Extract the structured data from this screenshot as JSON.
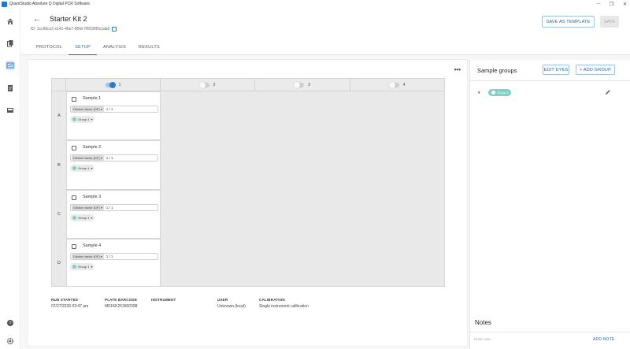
{
  "window": {
    "title": "QuantStudio Absolute Q Digital PCR Software",
    "minimize_glyph": "–",
    "maximize_glyph": "❐",
    "close_glyph": "✕"
  },
  "rail": {
    "items": [
      {
        "icon": "home-icon"
      },
      {
        "icon": "files-icon"
      },
      {
        "icon": "plate-setup-icon",
        "active": true
      },
      {
        "icon": "document-list-icon"
      },
      {
        "icon": "instrument-icon"
      }
    ],
    "bottom": [
      {
        "icon": "help-icon"
      },
      {
        "icon": "settings-icon"
      }
    ]
  },
  "header": {
    "back_glyph": "←",
    "title": "Starter Kit 2",
    "id_text": "ID: 1cc96cc2-c141-45e7-80fd-7f6539f0c1da0",
    "save_template_label": "SAVE AS TEMPLATE",
    "save_label": "SAVE",
    "tabs": [
      {
        "label": "PROTOCOL"
      },
      {
        "label": "SETUP"
      },
      {
        "label": "ANALYSIS"
      },
      {
        "label": "RESULTS"
      }
    ]
  },
  "plate": {
    "more_glyph": "•••",
    "columns": [
      {
        "label": "1",
        "on": true
      },
      {
        "label": "2",
        "on": false
      },
      {
        "label": "3",
        "on": false
      },
      {
        "label": "4",
        "on": false
      }
    ],
    "rows": [
      {
        "label": "A",
        "sample": "Sample 1",
        "df_chip": "Dilution factor (DF)",
        "df_value": "1 / 1",
        "group": "Group 1"
      },
      {
        "label": "B",
        "sample": "Sample 2",
        "df_chip": "Dilution factor (DF)",
        "df_value": "1 / 1",
        "group": "Group 1"
      },
      {
        "label": "C",
        "sample": "Sample 3",
        "df_chip": "Dilution factor (DF)",
        "df_value": "1 / 1",
        "group": "Group 1"
      },
      {
        "label": "D",
        "sample": "Sample 4",
        "df_chip": "Dilution factor (DF)",
        "df_value": "1 / 1",
        "group": "Group 1"
      }
    ],
    "chip_caret": "▾",
    "group_color": "#7fd0c6"
  },
  "run_meta": [
    {
      "label": "RUN STARTED",
      "value": "07/27/2026 03:47 pm"
    },
    {
      "label": "PLATE BARCODE",
      "value": "M01KK253900398"
    },
    {
      "label": "INSTRUMENT",
      "value": ""
    },
    {
      "label": "USER",
      "value": "Unknown (local)"
    },
    {
      "label": "CALIBRATION",
      "value": "Single instrument calibration"
    }
  ],
  "side": {
    "title": "Sample groups",
    "edit_dyes_label": "EDIT DYES",
    "add_group_label": "+ ADD GROUP",
    "group_caret": "▾",
    "group_name": "Group 1",
    "notes_title": "Notes",
    "note_placeholder": "Enter note...",
    "add_note_label": "ADD NOTE"
  },
  "colors": {
    "accent": "#2266b0",
    "toggle_on": "#2a7bd0",
    "group": "#7fd0c6"
  }
}
